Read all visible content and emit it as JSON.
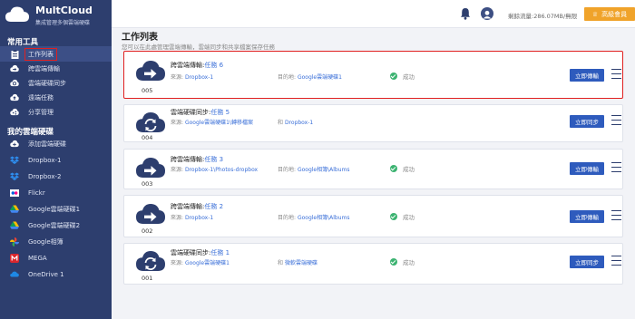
{
  "brand": {
    "name": "MultCloud",
    "tagline": "集成管理多個雲端硬碟"
  },
  "colors": {
    "sidebar": "#2d3e6e",
    "accent": "#2e5bbd",
    "vip": "#f0a32a",
    "highlight": "#e02020",
    "success": "#3cb371"
  },
  "sidebar": {
    "section_tools": "常用工具",
    "tools": [
      {
        "label": "工作列表",
        "icon": "clipboard-icon",
        "active": true
      },
      {
        "label": "跨雲端傳輸",
        "icon": "transfer-icon"
      },
      {
        "label": "雲端硬碟同步",
        "icon": "sync-icon"
      },
      {
        "label": "遠端任務",
        "icon": "remote-upload-icon"
      },
      {
        "label": "分享管理",
        "icon": "share-icon"
      }
    ],
    "section_drives": "我的雲端硬碟",
    "drives": [
      {
        "label": "添加雲端硬碟",
        "icon": "add-cloud-icon"
      },
      {
        "label": "Dropbox-1",
        "icon": "dropbox-icon"
      },
      {
        "label": "Dropbox-2",
        "icon": "dropbox-icon"
      },
      {
        "label": "Flickr",
        "icon": "flickr-icon"
      },
      {
        "label": "Google雲端硬碟1",
        "icon": "google-drive-icon"
      },
      {
        "label": "Google雲端硬碟2",
        "icon": "google-drive-icon"
      },
      {
        "label": "Google相簿",
        "icon": "google-photos-icon"
      },
      {
        "label": "MEGA",
        "icon": "mega-icon"
      },
      {
        "label": "OneDrive 1",
        "icon": "onedrive-icon"
      }
    ]
  },
  "topbar": {
    "traffic": "剩餘流量:286.07MB/無限",
    "vip_label": "高級會員"
  },
  "main": {
    "title": "工作列表",
    "subtitle": "您可以在此處管理雲端傳輸，雲端同步和共享檔案保存任務"
  },
  "tasks": [
    {
      "number": "005",
      "type": "跨雲端傳輸:",
      "task": "任務 6",
      "source_label": "來源:",
      "source": "Dropbox-1",
      "dest_label": "目的地:",
      "dest": "Google雲端硬碟1",
      "status": "成功",
      "action": "立即傳輸",
      "icon": "transfer-cloud-icon"
    },
    {
      "number": "004",
      "type": "雲端硬碟同步:",
      "task": "任務 5",
      "source_label": "來源:",
      "source": "Google雲端硬碟1\\轉移檔案",
      "dest_label": "和",
      "dest": "Dropbox-1",
      "status": "",
      "action": "立即同步",
      "icon": "sync-cloud-icon"
    },
    {
      "number": "003",
      "type": "跨雲端傳輸:",
      "task": "任務 3",
      "source_label": "來源:",
      "source": "Dropbox-1\\Photos-dropbox",
      "dest_label": "目的地:",
      "dest": "Google相簿\\Albums",
      "status": "成功",
      "action": "立即傳輸",
      "icon": "transfer-cloud-icon"
    },
    {
      "number": "002",
      "type": "跨雲端傳輸:",
      "task": "任務 2",
      "source_label": "來源:",
      "source": "Dropbox-1",
      "dest_label": "目的地:",
      "dest": "Google相簿\\Albums",
      "status": "成功",
      "action": "立即傳輸",
      "icon": "transfer-cloud-icon"
    },
    {
      "number": "001",
      "type": "雲端硬碟同步:",
      "task": "任務 1",
      "source_label": "來源:",
      "source": "Google雲端硬碟1",
      "dest_label": "和",
      "dest": "微軟雲端硬碟",
      "status": "成功",
      "action": "立即同步",
      "icon": "sync-cloud-icon"
    }
  ]
}
